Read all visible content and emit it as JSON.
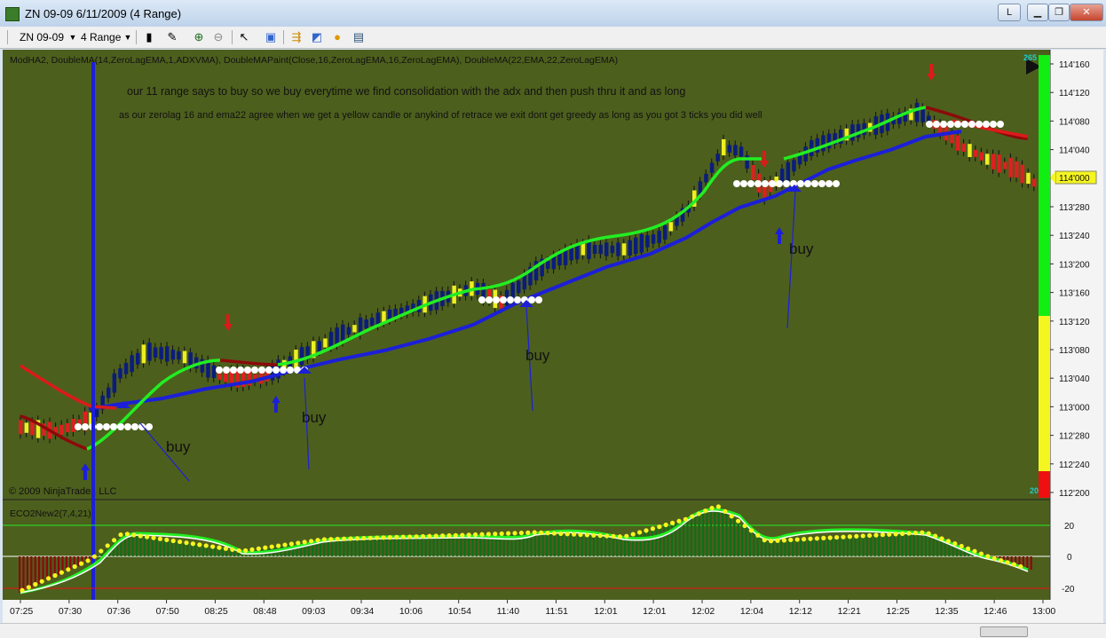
{
  "window": {
    "title": "ZN 09-09  6/11/2009 (4 Range)",
    "button_restore_label": "L"
  },
  "toolbar": {
    "instrument": "ZN 09-09",
    "period": "4 Range"
  },
  "chart": {
    "indicator_label": "ModHA2, DoubleMA(14,ZeroLagEMA,1,ADXVMA), DoubleMAPaint(Close,16,ZeroLagEMA,16,ZeroLagEMA), DoubleMA(22,EMA,22,ZeroLagEMA)",
    "annotation_line1": "our 11 range says to buy so we buy everytime we find consolidation with the adx and then push thru it and as long",
    "annotation_line2": "as our zerolag 16 and ema22 agree when we get a yellow candle or anykind of retrace we exit dont get greedy as long as you got 3 ticks you did well",
    "buy_labels": [
      "buy",
      "buy",
      "buy",
      "buy"
    ],
    "copyright": "© 2009 NinjaTrader, LLC",
    "price_axis": [
      "114'160",
      "114'120",
      "114'080",
      "114'040",
      "114'000",
      "113'280",
      "113'240",
      "113'200",
      "113'160",
      "113'120",
      "113'080",
      "113'040",
      "113'000",
      "112'280",
      "112'240",
      "112'200"
    ],
    "current_price": "114'000",
    "meter_top": "265",
    "meter_bottom": "20",
    "colors": {
      "background": "#4d5f1d",
      "ema_line": "#1c1fd8",
      "zerolag_up": "#22ee22",
      "zerolag_down": "#8b0a0a",
      "up_candle": "#0b1d7a",
      "down_candle": "#dd2020",
      "neutral_candle": "#eeee22"
    }
  },
  "oscillator": {
    "label": "ECO2New2(7,4,21)",
    "axis": [
      "20",
      "0",
      "-20"
    ]
  },
  "time_axis": [
    "07:25",
    "07:30",
    "07:36",
    "07:50",
    "08:25",
    "08:48",
    "09:03",
    "09:34",
    "10:06",
    "10:54",
    "11:40",
    "11:51",
    "12:01",
    "12:01",
    "12:02",
    "12:04",
    "12:12",
    "12:21",
    "12:25",
    "12:35",
    "12:46",
    "13:00"
  ]
}
